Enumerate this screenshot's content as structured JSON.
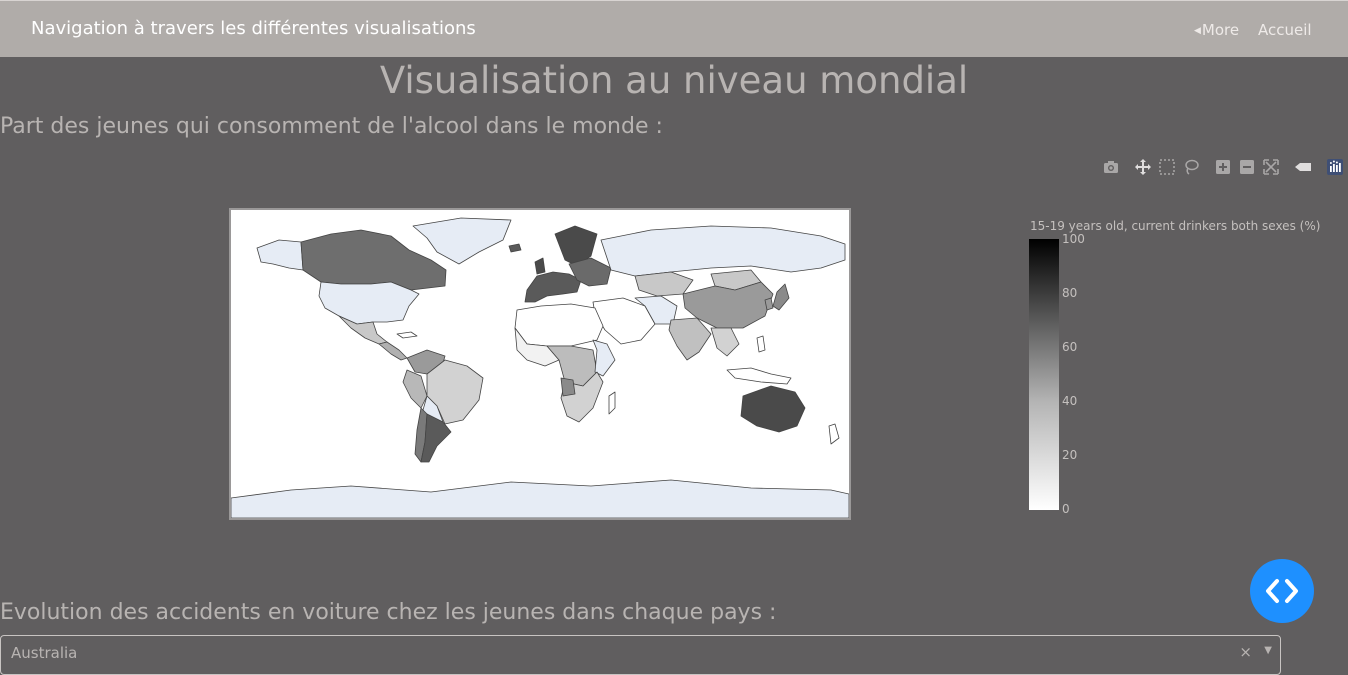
{
  "navbar": {
    "brand": "Navigation à travers les différentes visualisations",
    "more_label": "More",
    "home_label": "Accueil"
  },
  "page": {
    "title": "Visualisation au niveau mondial"
  },
  "section_map": {
    "title": "Part des jeunes qui consomment de l'alcool dans le monde :"
  },
  "section_accidents": {
    "title": "Evolution des accidents en voiture chez les jeunes dans chaque pays :"
  },
  "modebar": {
    "icons": [
      "camera-icon",
      "pan-icon",
      "box-select-icon",
      "lasso-icon",
      "zoom-in-icon",
      "zoom-out-icon",
      "reset-icon",
      "hover-icon",
      "plotly-logo-icon"
    ]
  },
  "colorbar": {
    "title": "15-19 years old, current drinkers both sexes (%)",
    "ticks": [
      "100",
      "80",
      "60",
      "40",
      "20",
      "0"
    ],
    "range": [
      0,
      100
    ],
    "colors": [
      "#000000",
      "#5a5a5a",
      "#b4b4b4",
      "#ffffff"
    ]
  },
  "map": {
    "land_missing_color": "#ffffff",
    "no_data_color": "#e6ecf5",
    "border_color": "#444444"
  },
  "dropdown": {
    "value": "Australia",
    "clear_symbol": "×"
  },
  "colors": {
    "background": "#605e5f",
    "navbar": "#b0aca9",
    "fab": "#1e90ff"
  }
}
